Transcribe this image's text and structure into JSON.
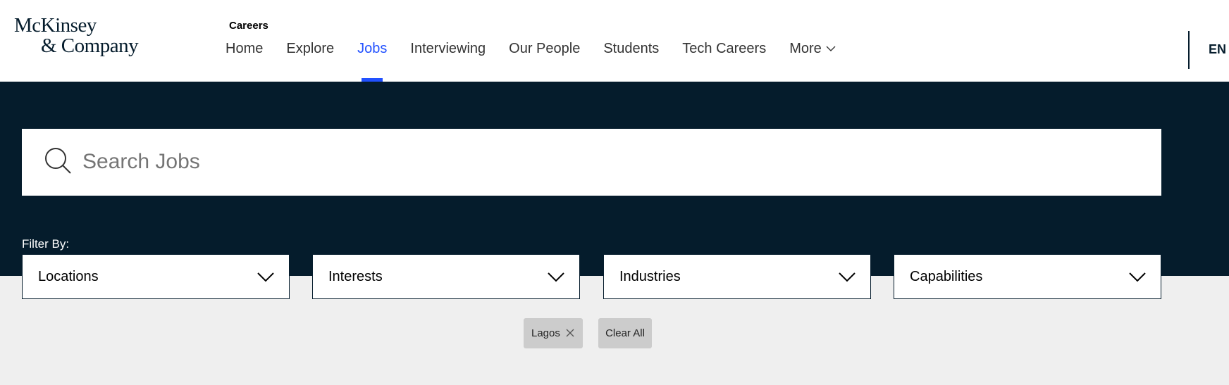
{
  "brand": {
    "line1": "McKinsey",
    "line2": "& Company"
  },
  "header": {
    "section_label": "Careers",
    "nav": [
      {
        "label": "Home"
      },
      {
        "label": "Explore"
      },
      {
        "label": "Jobs",
        "active": true
      },
      {
        "label": "Interviewing"
      },
      {
        "label": "Our People"
      },
      {
        "label": "Students"
      },
      {
        "label": "Tech Careers"
      },
      {
        "label": "More",
        "icon": "chevron-down-icon"
      }
    ],
    "language": "EN"
  },
  "search": {
    "placeholder": "Search Jobs",
    "value": "",
    "icon": "search-icon"
  },
  "filters": {
    "label": "Filter By:",
    "dropdowns": [
      {
        "label": "Locations"
      },
      {
        "label": "Interests"
      },
      {
        "label": "Industries"
      },
      {
        "label": "Capabilities"
      }
    ]
  },
  "active_filters": {
    "chips": [
      {
        "label": "Lagos",
        "icon": "close-icon"
      }
    ],
    "clear_all": "Clear All"
  },
  "colors": {
    "navy": "#051c2c",
    "accent": "#2251ff",
    "background": "#efefef",
    "chip": "#cccccc"
  }
}
